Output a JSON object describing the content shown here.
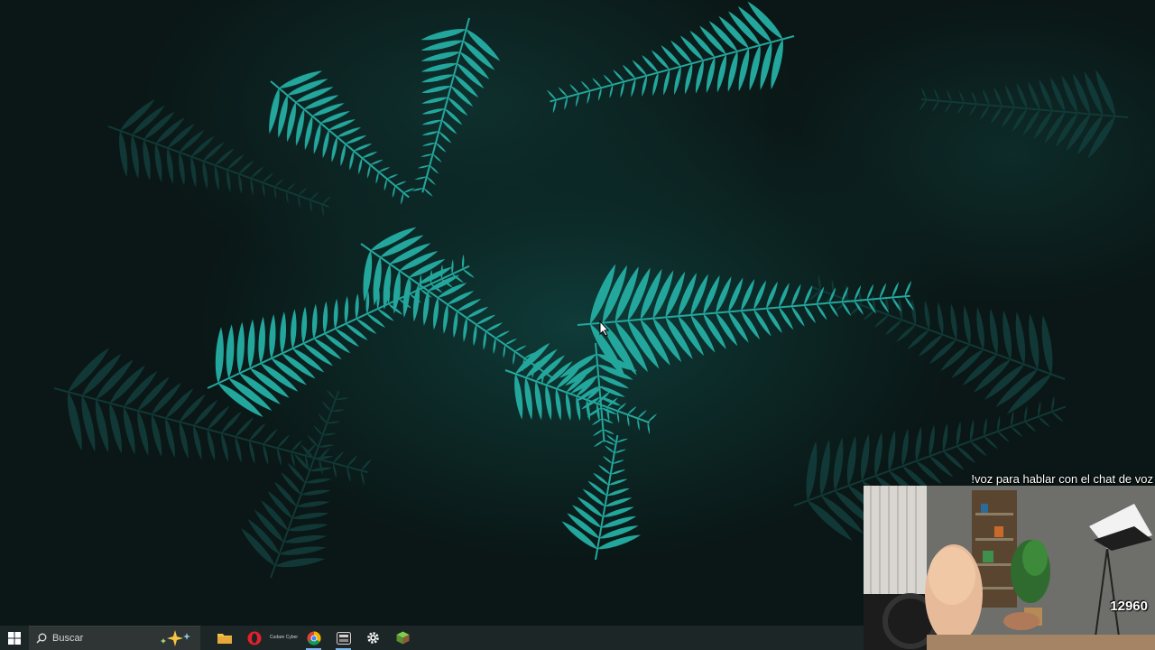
{
  "desktop": {
    "wallpaper": "fern-leaves",
    "accent_color": "#2fb5a9"
  },
  "stream_overlay": {
    "chat_command_text": "!voz para hablar con el chat de voz",
    "viewer_badge": "12960"
  },
  "taskbar": {
    "search_placeholder": "Buscar",
    "icons": [
      {
        "name": "file-explorer-icon"
      },
      {
        "name": "opera-icon"
      },
      {
        "name": "app-icon",
        "label": "Cudare Cyber"
      },
      {
        "name": "chrome-icon"
      },
      {
        "name": "media-player-icon"
      },
      {
        "name": "settings-icon"
      },
      {
        "name": "minecraft-icon"
      }
    ]
  }
}
